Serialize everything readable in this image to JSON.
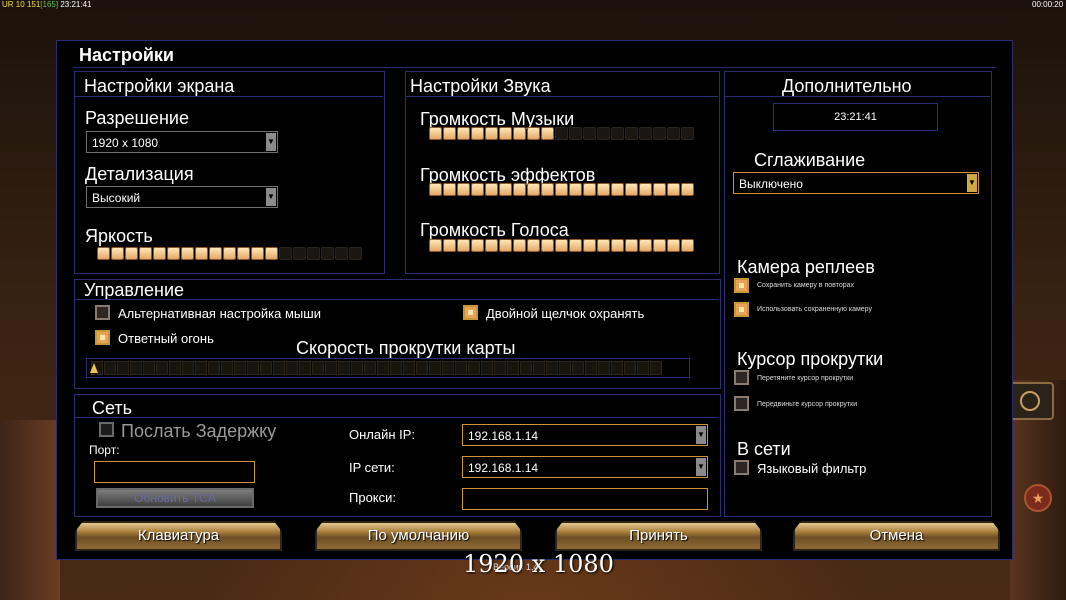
{
  "topbar": {
    "left_a": "UR",
    "left_b": "10",
    "left_c": "151",
    "left_d": "[165]",
    "left_time": "23:21:41",
    "right_time": "00:00:20"
  },
  "title": "Настройки",
  "screen": {
    "title": "Настройки экрана",
    "resolution_label": "Разрешение",
    "resolution_value": "1920 x 1080",
    "detail_label": "Детализация",
    "detail_value": "Высокий",
    "brightness_label": "Яркость",
    "brightness_level": 0.67
  },
  "sound": {
    "title": "Настройки Звука",
    "music_label": "Громкость Музыки",
    "music_level": 0.46,
    "effects_label": "Громкость эффектов",
    "effects_level": 1.0,
    "voice_label": "Громкость Голоса",
    "voice_level": 1.0
  },
  "extra": {
    "title": "Дополнительно",
    "clock": "23:21:41",
    "aa_label": "Сглаживание",
    "aa_value": "Выключено",
    "replay_cam_title": "Камера реплеев",
    "replay_opt1": "Сохранить камеру в повторах",
    "replay_opt2": "Использовать сохраненную камеру",
    "scroll_cursor_title": "Курсор прокрутки",
    "scroll_opt1": "Перетяните курсор прокрутки",
    "scroll_opt2": "Передвиньте курсор прокрутки",
    "online_title": "В сети",
    "lang_filter": "Языковый фильтр"
  },
  "controls": {
    "title": "Управление",
    "alt_mouse": "Альтернативная настройка мыши",
    "double_click": "Двойной щелчок охранять",
    "return_fire": "Ответный огонь",
    "scroll_speed_label": "Скорость прокрутки карты",
    "scroll_speed_level": 0.0
  },
  "network": {
    "title": "Сеть",
    "send_delay": "Послать Задержку",
    "port_label": "Порт:",
    "update_tca": "Обновить TCA",
    "online_ip_label": "Онлайн IP:",
    "online_ip": "192.168.1.14",
    "lan_ip_label": "IP сети:",
    "lan_ip": "192.168.1.14",
    "proxy_label": "Прокси:"
  },
  "buttons": {
    "keyboard": "Клавиатура",
    "defaults": "По умолчанию",
    "accept": "Принять",
    "cancel": "Отмена"
  },
  "footer": {
    "resolution": "1920 x 1080",
    "version": "Версия 1.4"
  },
  "colors": {
    "panel_border": "#2c2c70",
    "accent": "#c89632",
    "bar_on": "#e6a866"
  }
}
